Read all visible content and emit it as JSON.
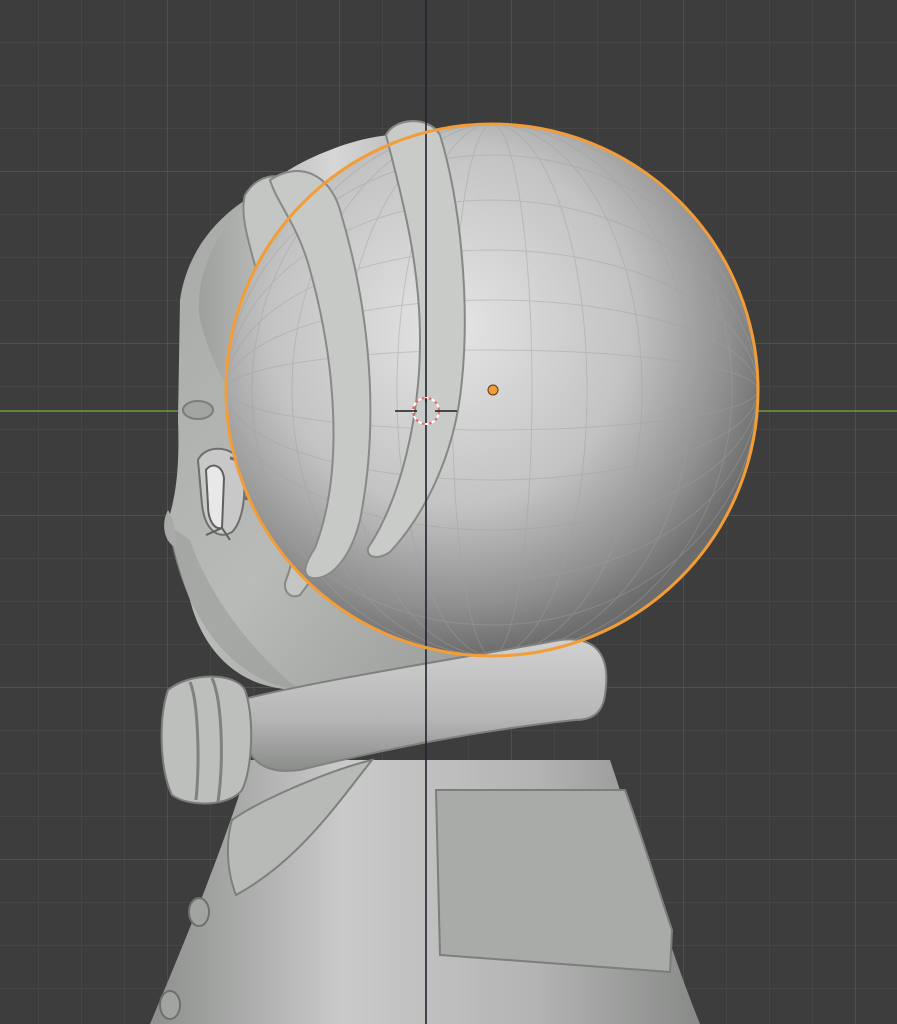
{
  "viewport": {
    "background": "#3d3d3d",
    "grid_minor_color": "#4a4a4a",
    "grid_major_color": "#575757",
    "axis_y_color": "#6e9a3a",
    "axis_z_color": "#1e2230",
    "selection_color": "#f29d38"
  },
  "scene": {
    "model": "chibi-character-side-view",
    "mesh_color": "#b9bbb9",
    "selected_object": "sphere-hair-bun",
    "cursor": "3d-cursor"
  }
}
